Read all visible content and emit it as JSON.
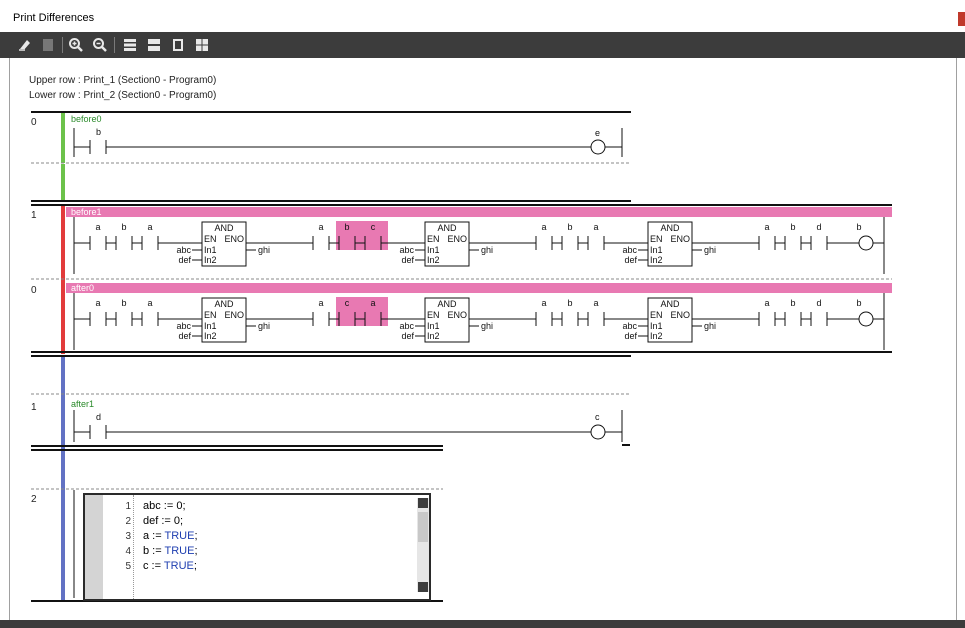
{
  "window": {
    "title": "Print Differences",
    "accent_color": "#c0392b"
  },
  "toolbar": {
    "buttons": [
      {
        "icon": "print-icon",
        "enabled": true
      },
      {
        "icon": "page-icon",
        "enabled": false
      },
      {
        "icon": "zoom-in-icon",
        "enabled": true
      },
      {
        "icon": "zoom-out-icon",
        "enabled": true
      },
      {
        "icon": "layout-rows-icon",
        "enabled": true
      },
      {
        "icon": "layout-grid-icon",
        "enabled": true
      },
      {
        "icon": "single-page-icon",
        "enabled": true
      },
      {
        "icon": "multi-page-icon",
        "enabled": true
      }
    ]
  },
  "header": {
    "upper_row": "Upper row : Print_1 (Section0 - Program0)",
    "lower_row": "Lower row : Print_2 (Section0 - Program0)"
  },
  "colors": {
    "unchanged": "#6cc24a",
    "changed": "#e23b3b",
    "moved": "#6272c4",
    "diff_highlight": "#e879b2"
  },
  "rungs": [
    {
      "number": "0",
      "label": "before0",
      "contacts": [
        "b"
      ],
      "coil": "e"
    },
    {
      "number": "1",
      "label": "before1",
      "groups": [
        [
          "a",
          "b",
          "a"
        ],
        [
          "a",
          "b",
          "c"
        ],
        [
          "a",
          "b",
          "a"
        ],
        [
          "a",
          "b",
          "d"
        ]
      ],
      "coil": "b",
      "block": {
        "name": "AND",
        "en": "EN",
        "eno": "ENO",
        "in1": "In1",
        "in2": "In2",
        "arg1": "abc",
        "arg2": "def",
        "out": "ghi"
      }
    },
    {
      "number": "0",
      "label": "after0",
      "groups": [
        [
          "a",
          "b",
          "a"
        ],
        [
          "a",
          "c",
          "a"
        ],
        [
          "a",
          "b",
          "a"
        ],
        [
          "a",
          "b",
          "d"
        ]
      ],
      "coil": "b"
    },
    {
      "number": "1",
      "label": "after1",
      "contacts": [
        "d"
      ],
      "coil": "c"
    },
    {
      "number": "2"
    }
  ],
  "code": {
    "line_numbers": [
      "1",
      "2",
      "3",
      "4",
      "5"
    ],
    "lines": [
      {
        "text": "abc := 0;"
      },
      {
        "text": "def := 0;"
      },
      {
        "pre": "a := ",
        "kw": "TRUE",
        "post": ";"
      },
      {
        "pre": "b := ",
        "kw": "TRUE",
        "post": ";"
      },
      {
        "pre": "c := ",
        "kw": "TRUE",
        "post": ";"
      }
    ]
  }
}
